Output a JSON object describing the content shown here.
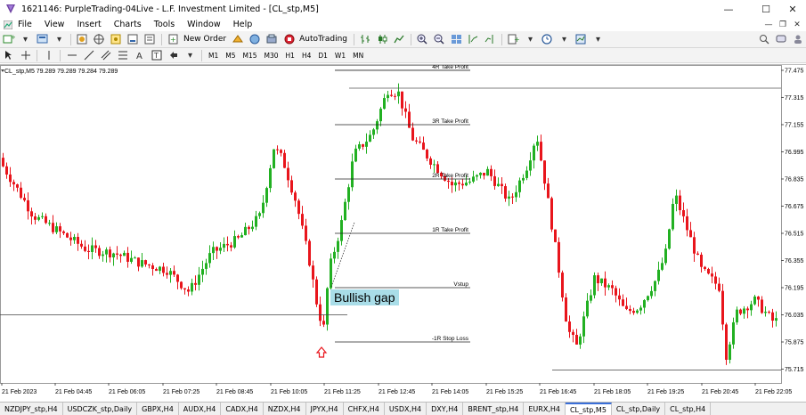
{
  "window": {
    "title": "1621146: PurpleTrading-04Live - L.F. Investment Limited - [CL_stp,M5]"
  },
  "menu": {
    "items": [
      "File",
      "View",
      "Insert",
      "Charts",
      "Tools",
      "Window",
      "Help"
    ]
  },
  "toolbar": {
    "new_order": "New Order",
    "autotrading": "AutoTrading"
  },
  "timeframes": [
    "M1",
    "M5",
    "M15",
    "M30",
    "H1",
    "H4",
    "D1",
    "W1",
    "MN"
  ],
  "chart_header": "CL_stp,M5  79.289 79.289 79.284 79.289",
  "chart_data": {
    "type": "candlestick",
    "y_ticks": [
      "77.475",
      "77.315",
      "77.155",
      "76.995",
      "76.835",
      "76.675",
      "76.515",
      "76.355",
      "76.195",
      "76.035",
      "75.875",
      "75.715"
    ],
    "x_ticks": [
      "21 Feb 2023",
      "21 Feb 04:45",
      "21 Feb 06:05",
      "21 Feb 07:25",
      "21 Feb 08:45",
      "21 Feb 10:05",
      "21 Feb 11:25",
      "21 Feb 12:45",
      "21 Feb 14:05",
      "21 Feb 15:25",
      "21 Feb 16:45",
      "21 Feb 18:05",
      "21 Feb 19:25",
      "21 Feb 20:45",
      "21 Feb 22:05"
    ],
    "ylim": [
      75.66,
      77.48
    ],
    "levels": [
      {
        "label": "4R Take Profit",
        "price": 77.475
      },
      {
        "label": "3R Take Profit",
        "price": 77.155
      },
      {
        "label": "2R Take Profit",
        "price": 76.835
      },
      {
        "label": "1R Take Profit",
        "price": 76.515
      },
      {
        "label": "Vstup",
        "price": 76.195
      },
      {
        "label": "-1R Stop Loss",
        "price": 75.875
      }
    ],
    "annotation": "Bullish gap",
    "colors": {
      "bull": "#22b022",
      "bear": "#e8151c"
    }
  },
  "tabs": [
    "NZDJPY_stp,H4",
    "USDCZK_stp,Daily",
    "GBPX,H4",
    "AUDX,H4",
    "CADX,H4",
    "NZDX,H4",
    "JPYX,H4",
    "CHFX,H4",
    "USDX,H4",
    "DXY,H4",
    "BRENT_stp,H4",
    "EURX,H4",
    "CL_stp,M5",
    "CL_stp,Daily",
    "CL_stp,H4"
  ],
  "active_tab": "CL_stp,M5"
}
